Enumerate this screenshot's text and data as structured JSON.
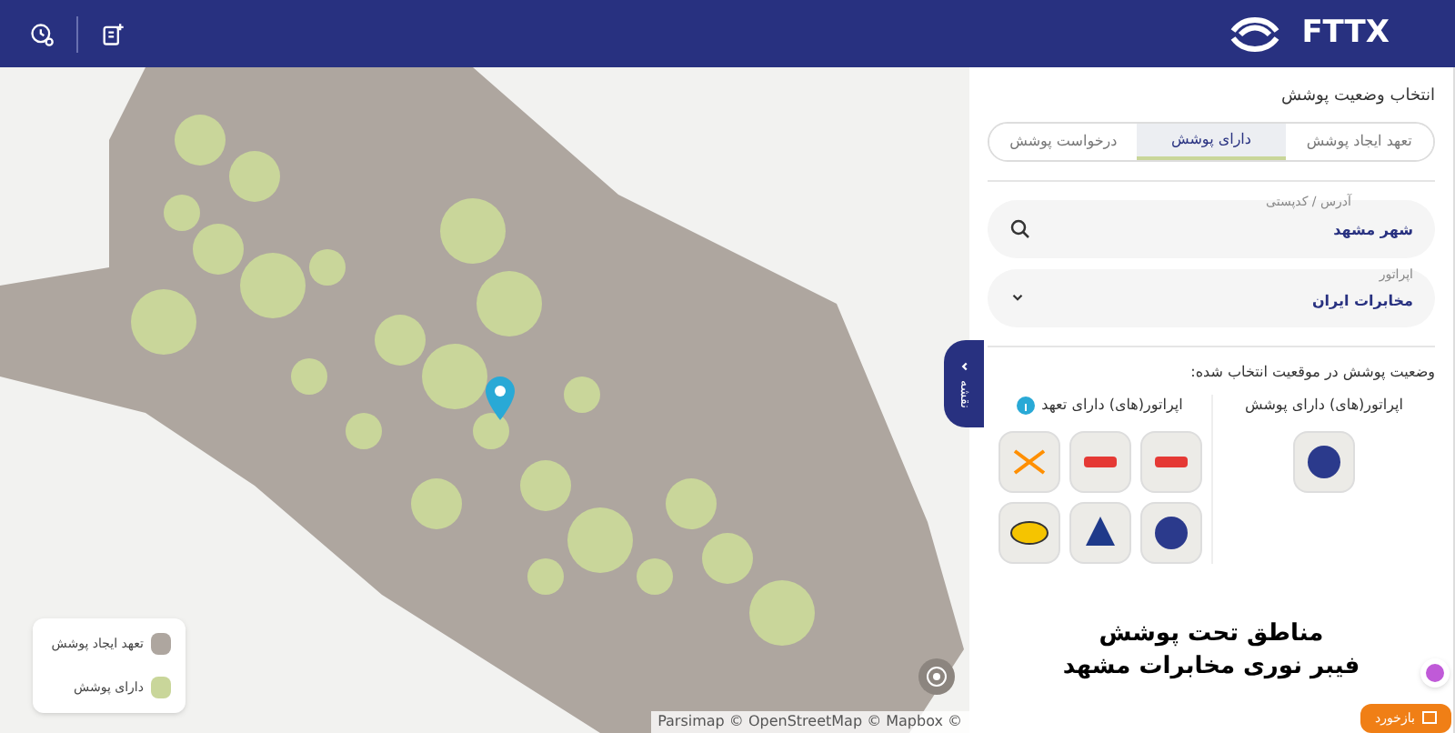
{
  "header": {
    "logo_text": "FTTX"
  },
  "panel": {
    "title": "انتخاب وضعیت پوشش",
    "tabs": [
      {
        "label": "تعهد ایجاد پوشش",
        "selected": false
      },
      {
        "label": "دارای پوشش",
        "selected": true
      },
      {
        "label": "درخواست پوشش",
        "selected": false
      }
    ],
    "address_field": {
      "label": "آدرس / کدپستی",
      "value": "شهر مشهد"
    },
    "operator_select": {
      "label": "اپراتور",
      "value": "مخابرات ایران"
    },
    "status_heading": "وضعیت پوشش در موقعیت انتخاب شده:",
    "covered_column": {
      "title": "اپراتور(های) دارای پوشش",
      "logos": [
        {
          "kind": "globe"
        }
      ]
    },
    "committed_column": {
      "title": "اپراتور(های) دارای تعهد",
      "logos": [
        {
          "kind": "wordmark"
        },
        {
          "kind": "wordmark"
        },
        {
          "kind": "cross"
        },
        {
          "kind": "globe"
        },
        {
          "kind": "triangle"
        },
        {
          "kind": "oval"
        }
      ]
    },
    "caption": [
      "مناطق تحت پوشش",
      "فیبر نوری مخابرات مشهد"
    ],
    "side_tab": "نقشه",
    "feedback_button": "بازخورد"
  },
  "map": {
    "legend": [
      {
        "label": "تعهد ایجاد پوشش",
        "color": "#aea69f"
      },
      {
        "label": "دارای پوشش",
        "color": "#c9d69a"
      }
    ],
    "attribution": "Parsimap © OpenStreetMap © Mapbox ©"
  }
}
